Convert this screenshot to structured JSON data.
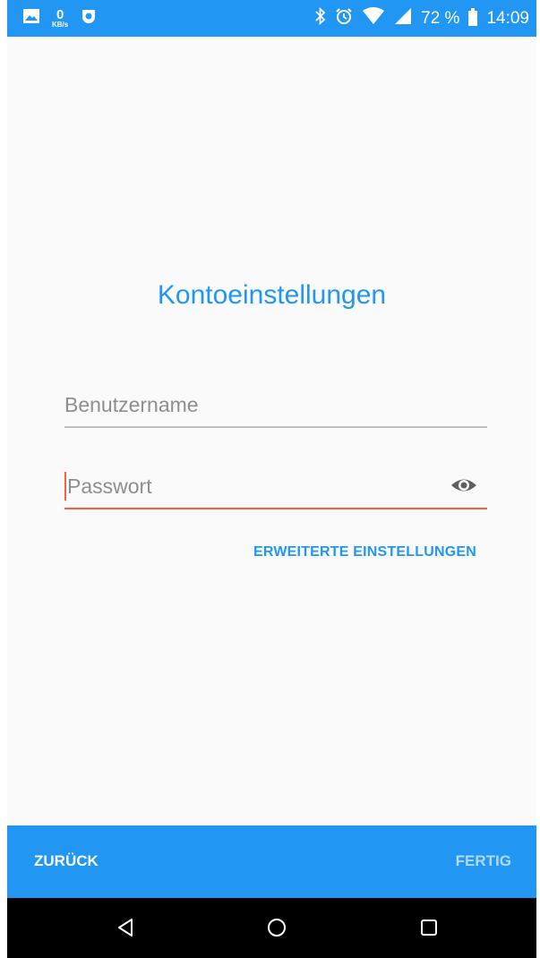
{
  "status_bar": {
    "kbs_value": "0",
    "kbs_unit": "KB/s",
    "battery": "72 %",
    "time": "14:09"
  },
  "screen": {
    "title": "Kontoeinstellungen"
  },
  "form": {
    "username_placeholder": "Benutzername",
    "password_placeholder": "Passwort",
    "advanced_link": "ERWEITERTE EINSTELLUNGEN"
  },
  "bottom_bar": {
    "back_label": "ZURÜCK",
    "done_label": "FERTIG"
  },
  "icons": {
    "status_left": [
      "image-icon",
      "data-speed-icon",
      "app-notification-icon"
    ],
    "status_right": [
      "bluetooth-icon",
      "alarm-icon",
      "wifi-icon",
      "cell-signal-icon",
      "battery-icon"
    ],
    "navigation": [
      "back-nav-icon",
      "home-nav-icon",
      "recents-nav-icon"
    ],
    "password_toggle": "eye-icon"
  },
  "colors": {
    "accent": "#2196F3",
    "error_underline": "#f4643c",
    "background": "#fafafa",
    "navbar": "#000000"
  }
}
